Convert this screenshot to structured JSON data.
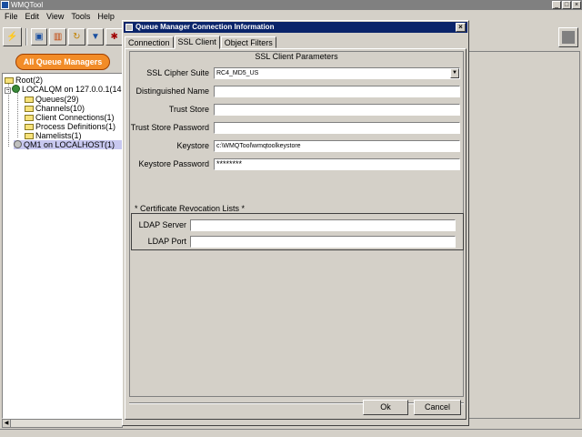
{
  "app": {
    "title": "WMQTool"
  },
  "menu": [
    "File",
    "Edit",
    "View",
    "Tools",
    "Help"
  ],
  "toolbar": {
    "icons": [
      "connect-icon",
      "window-icon",
      "chart-icon",
      "refresh-icon",
      "filter-icon",
      "settings-icon"
    ],
    "all_queue_managers_label": "All Queue Managers"
  },
  "tree": {
    "root": "Root(2)",
    "localqm": "LOCALQM on 127.0.0.1(14",
    "children": [
      "Queues(29)",
      "Channels(10)",
      "Client Connections(1)",
      "Process Definitions(1)",
      "Namelists(1)"
    ],
    "qm1": "QM1 on LOCALHOST(1)"
  },
  "dialog": {
    "title": "Queue Manager Connection Information",
    "tabs": [
      "Connection",
      "SSL Client",
      "Object Filters"
    ],
    "active_tab": "SSL Client",
    "section_title": "SSL Client Parameters",
    "fields": {
      "cipher_suite": {
        "label": "SSL Cipher Suite",
        "value": "RC4_MD5_US"
      },
      "distinguished_name": {
        "label": "Distinguished Name",
        "value": ""
      },
      "trust_store": {
        "label": "Trust Store",
        "value": ""
      },
      "trust_store_password": {
        "label": "Trust Store Password",
        "value": ""
      },
      "keystore": {
        "label": "Keystore",
        "value": "c:\\WMQTool\\wmqtoolkeystore"
      },
      "keystore_password": {
        "label": "Keystore Password",
        "value": "********"
      }
    },
    "crl": {
      "title": "* Certificate Revocation Lists *",
      "ldap_server": {
        "label": "LDAP Server",
        "value": ""
      },
      "ldap_port": {
        "label": "LDAP Port",
        "value": ""
      }
    },
    "buttons": {
      "ok": "Ok",
      "cancel": "Cancel"
    }
  }
}
